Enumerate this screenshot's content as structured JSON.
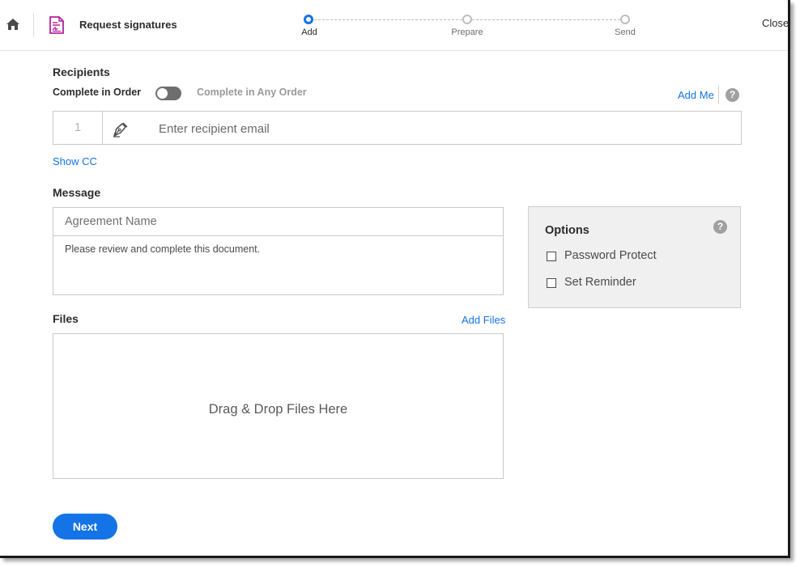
{
  "header": {
    "title": "Request signatures",
    "close_label": "Close",
    "home_icon": "home-icon",
    "doc_icon": "signature-document-icon",
    "accent_color": "#1473e6",
    "doc_icon_color": "#b1229f"
  },
  "stepper": {
    "steps": [
      {
        "label": "Add",
        "active": true
      },
      {
        "label": "Prepare",
        "active": false
      },
      {
        "label": "Send",
        "active": false
      }
    ]
  },
  "recipients": {
    "heading": "Recipients",
    "order_in_label": "Complete in Order",
    "order_any_label": "Complete in Any Order",
    "add_me_label": "Add Me",
    "help_glyph": "?",
    "row_number": "1",
    "role_icon": "pen-nib-icon",
    "email_placeholder": "Enter recipient email",
    "show_cc_label": "Show CC"
  },
  "message": {
    "heading": "Message",
    "agreement_name_placeholder": "Agreement Name",
    "body_text": "Please review and complete this document."
  },
  "options": {
    "title": "Options",
    "help_glyph": "?",
    "items": [
      {
        "label": "Password Protect",
        "checked": false
      },
      {
        "label": "Set Reminder",
        "checked": false
      }
    ]
  },
  "files": {
    "heading": "Files",
    "add_files_label": "Add Files",
    "dropzone_text": "Drag & Drop Files Here"
  },
  "footer": {
    "next_label": "Next"
  }
}
